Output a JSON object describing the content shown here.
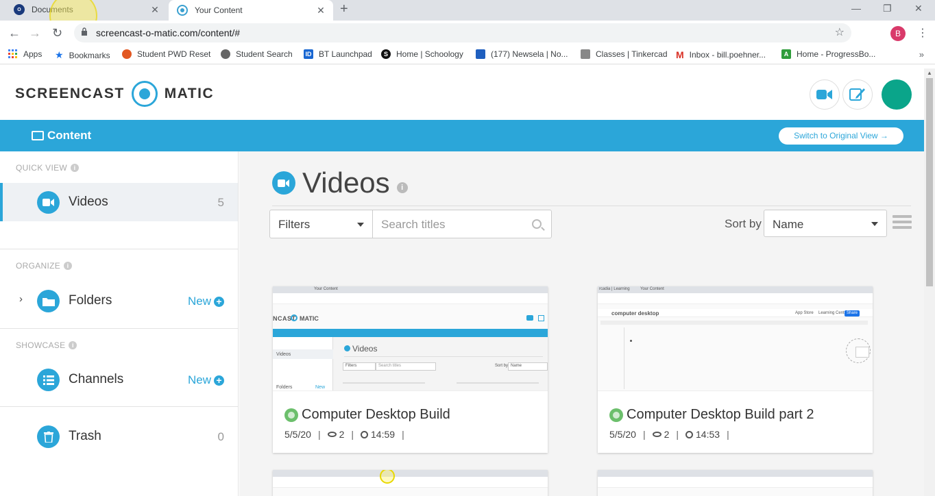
{
  "browser": {
    "tabs": [
      {
        "title": "Documents",
        "favicon_text": "O"
      },
      {
        "title": "Your Content"
      }
    ],
    "url": "screencast-o-matic.com/content/#",
    "profile_initial": "B",
    "bookmarks": [
      {
        "label": "Apps",
        "icon": "apps-grid-icon",
        "color": "#4285f4"
      },
      {
        "label": "Bookmarks",
        "icon": "star-icon",
        "color": "#1a73e8"
      },
      {
        "label": "Student PWD Reset",
        "icon": "leaf-icon",
        "color": "#e25822"
      },
      {
        "label": "Student Search",
        "icon": "globe-icon",
        "color": "#555555"
      },
      {
        "label": "BT Launchpad",
        "icon": "id-icon",
        "color": "#1967d2"
      },
      {
        "label": "Home | Schoology",
        "icon": "schoology-icon",
        "color": "#111111"
      },
      {
        "label": "(177) Newsela | No...",
        "icon": "newsela-icon",
        "color": "#1f5fbf"
      },
      {
        "label": "Classes | Tinkercad",
        "icon": "tinkercad-icon",
        "color": "#777777"
      },
      {
        "label": "Inbox - bill.poehner...",
        "icon": "gmail-icon",
        "color": "#d93025"
      },
      {
        "label": "Home - ProgressBo...",
        "icon": "progressbook-icon",
        "color": "#2e9c3a"
      }
    ]
  },
  "header": {
    "logo_left": "SCREENCAST",
    "logo_right": "MATIC"
  },
  "bluebar": {
    "content_label": "Content",
    "switch_label": "Switch to Original View →"
  },
  "sidebar": {
    "quick_view": "QUICK VIEW",
    "organize": "ORGANIZE",
    "showcase": "SHOWCASE",
    "items": [
      {
        "label": "Videos",
        "count": "5"
      },
      {
        "label": "Folders",
        "new": "New"
      },
      {
        "label": "Channels",
        "new": "New"
      },
      {
        "label": "Trash",
        "count": "0"
      }
    ]
  },
  "main": {
    "title": "Videos",
    "filters_label": "Filters",
    "search_placeholder": "Search titles",
    "sort_by_label": "Sort by",
    "sort_value": "Name",
    "cards": [
      {
        "title": "Computer Desktop Build",
        "date": "5/5/20",
        "views": "2",
        "duration": "14:59"
      },
      {
        "title": "Computer Desktop Build part 2",
        "date": "5/5/20",
        "views": "2",
        "duration": "14:53"
      }
    ]
  },
  "thumb1": {
    "logo": "NCAST",
    "logo2": "MATIC",
    "videos": "Videos",
    "side_videos": "Videos",
    "side_folders": "Folders",
    "side_new": "New",
    "filters": "Filters",
    "search": "Search titles",
    "sort": "Sort by",
    "name": "Name",
    "tab": "Your Content"
  },
  "thumb2": {
    "doc_title": "computer desktop",
    "app_store": "App Store",
    "learning": "Learning Center",
    "share": "Share",
    "tab1": "rcadia | Learning",
    "tab2": "Your Content"
  },
  "colors": {
    "brand": "#2ba6d9",
    "avatar": "#0aa58a",
    "published": "#6cbf6c"
  }
}
